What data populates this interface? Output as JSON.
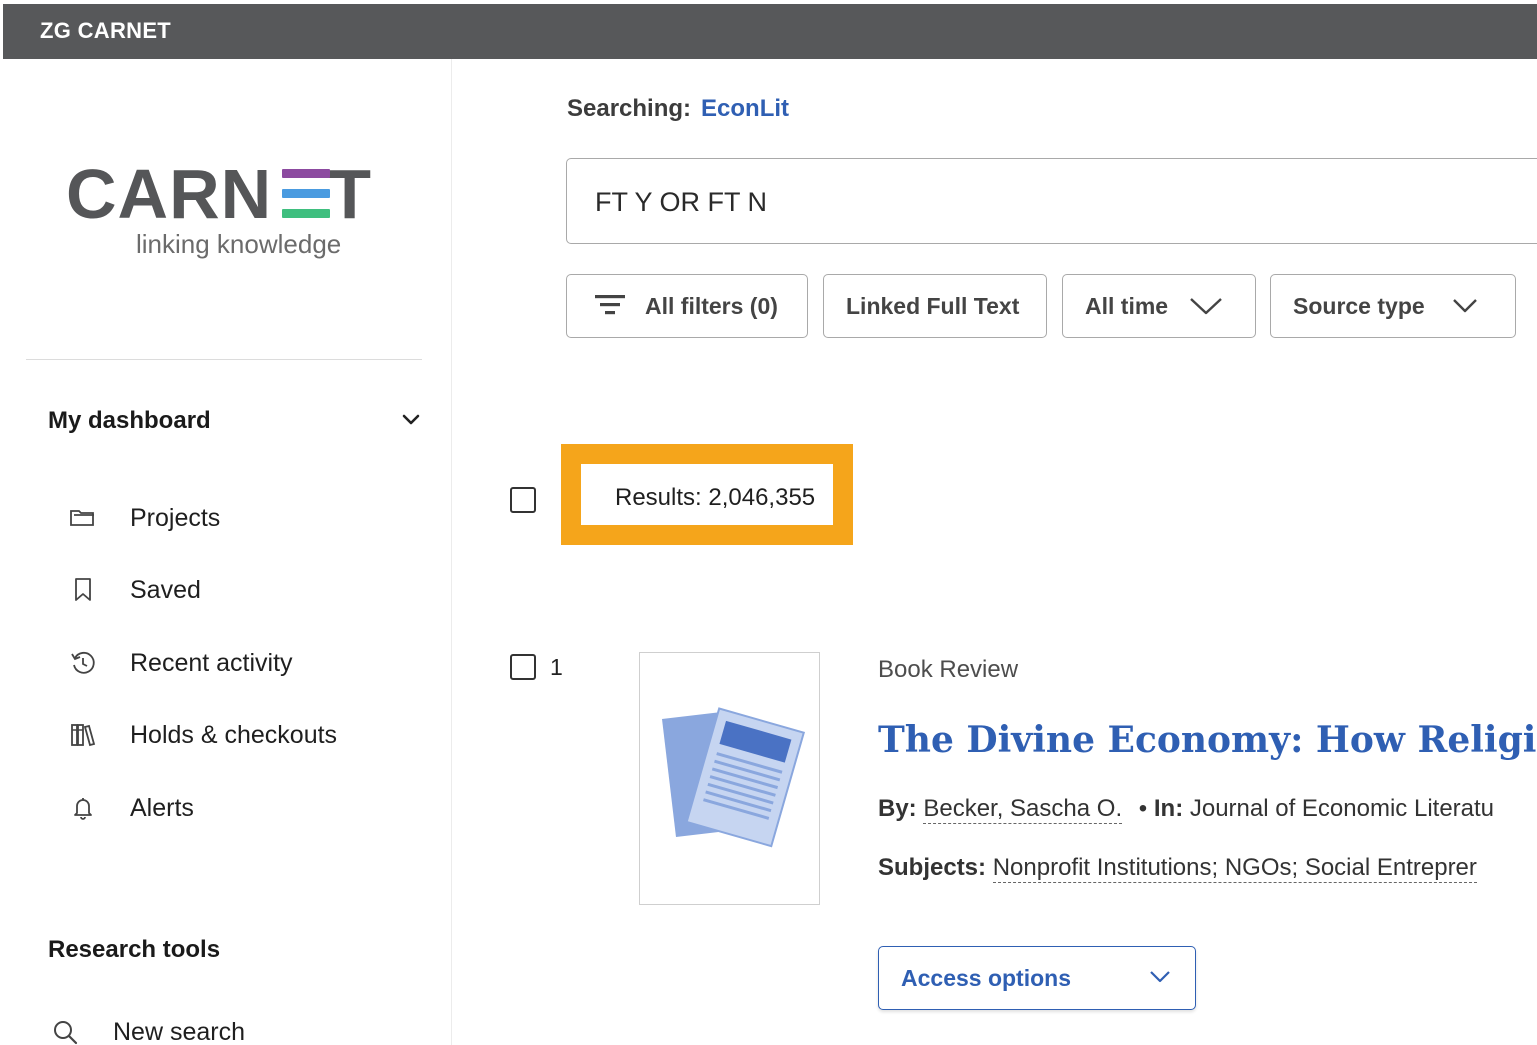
{
  "topbar": {
    "brand": "ZG CARNET"
  },
  "logo": {
    "word": "CARN",
    "word_end": "T",
    "tagline": "linking knowledge"
  },
  "sidebar": {
    "dashboard_title": "My dashboard",
    "items": [
      {
        "label": "Projects",
        "icon": "folders-icon"
      },
      {
        "label": "Saved",
        "icon": "bookmark-icon"
      },
      {
        "label": "Recent activity",
        "icon": "history-icon"
      },
      {
        "label": "Holds & checkouts",
        "icon": "books-icon"
      },
      {
        "label": "Alerts",
        "icon": "bell-icon"
      }
    ],
    "tools_title": "Research tools",
    "tools": [
      {
        "label": "New search",
        "icon": "search-icon"
      }
    ]
  },
  "search": {
    "searching_label": "Searching:",
    "database": "EconLit",
    "query": "FT Y OR FT N"
  },
  "filters": {
    "all_filters": "All filters (0)",
    "linked_full_text": "Linked Full Text",
    "all_time": "All time",
    "source_type": "Source type"
  },
  "results": {
    "count_text": "Results: 2,046,355",
    "items": [
      {
        "number": "1",
        "type": "Book Review",
        "title": "The Divine Economy: How Religions",
        "by_label": "By:",
        "author": "Becker, Sascha O.",
        "in_label": "In:",
        "journal": "Journal of Economic Literatu",
        "subjects_label": "Subjects:",
        "subjects": "Nonprofit Institutions; NGOs; Social Entreprer",
        "access_label": "Access options"
      }
    ]
  },
  "colors": {
    "topbar": "#57585a",
    "link_blue": "#2f5fb3",
    "highlight": "#f5a51b",
    "logo_purple": "#8c4aa0",
    "logo_blue": "#4a9be0",
    "logo_green": "#3fbf7f"
  }
}
